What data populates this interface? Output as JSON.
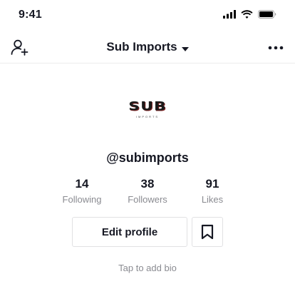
{
  "status_bar": {
    "time": "9:41"
  },
  "header": {
    "title": "Sub Imports",
    "icons": {
      "left": "add-user-icon",
      "title_caret": "caret-down-icon",
      "right": "more-horizontal-icon"
    }
  },
  "profile": {
    "avatar_logo": {
      "main": "SUB",
      "sub": "IMPORTS"
    },
    "username": "@subimports",
    "stats": [
      {
        "value": "14",
        "label": "Following"
      },
      {
        "value": "38",
        "label": "Followers"
      },
      {
        "value": "91",
        "label": "Likes"
      }
    ],
    "edit_label": "Edit profile",
    "bookmark_icon": "bookmark-icon",
    "bio_placeholder": "Tap to add bio"
  },
  "colors": {
    "text": "#161823",
    "muted": "#8a8b91",
    "border": "#e1e1e3",
    "logo_accent": "#7a1f1f"
  }
}
